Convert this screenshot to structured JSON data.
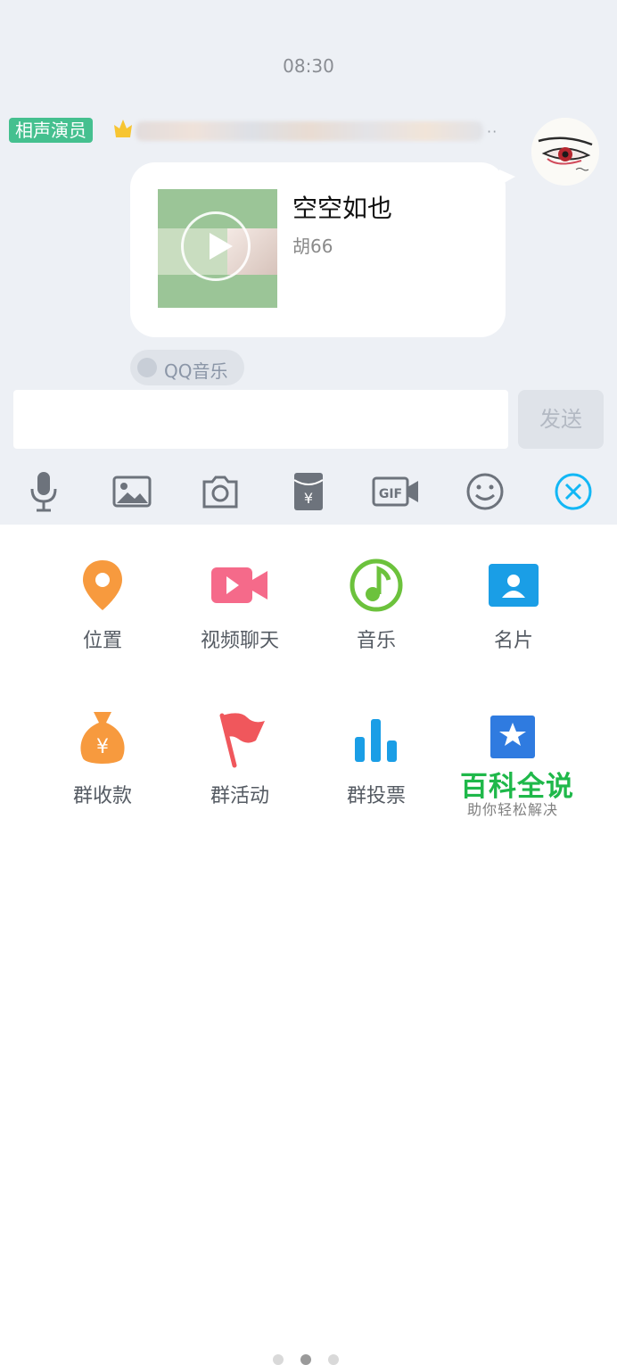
{
  "chat": {
    "timestamp": "08:30",
    "sender_badge": "相声演员",
    "sender_name_suffix": "··"
  },
  "music_card": {
    "song_title": "空空如也",
    "artist": "胡66",
    "source_app": "QQ音乐"
  },
  "composer": {
    "input_value": "",
    "send_label": "发送"
  },
  "toolbar": {
    "icons": [
      "microphone-icon",
      "image-icon",
      "camera-icon",
      "red-packet-icon",
      "gif-icon",
      "emoji-icon",
      "close-icon"
    ]
  },
  "panel": {
    "items": [
      {
        "label": "位置",
        "icon": "location-icon",
        "color": "#f79a3e"
      },
      {
        "label": "视频聊天",
        "icon": "video-call-icon",
        "color": "#f56a8a"
      },
      {
        "label": "音乐",
        "icon": "music-icon",
        "color": "#6cc23c"
      },
      {
        "label": "名片",
        "icon": "contact-card-icon",
        "color": "#1a9ee6"
      },
      {
        "label": "群收款",
        "icon": "money-bag-icon",
        "color": "#f79a3e"
      },
      {
        "label": "群活动",
        "icon": "flag-icon",
        "color": "#f0575c"
      },
      {
        "label": "群投票",
        "icon": "vote-chart-icon",
        "color": "#1a9ee6"
      },
      {
        "label": "",
        "icon": "star-card-icon",
        "color": "#2f7be0"
      }
    ]
  },
  "pager": {
    "pages": 3,
    "active": 2
  },
  "watermark": {
    "title": "百科全说",
    "subtitle": "助你轻松解决"
  },
  "colors": {
    "chat_bg": "#edf0f5",
    "badge_green": "#45c08f",
    "accent_blue": "#12b7f5",
    "icon_gray": "#6d737c"
  }
}
